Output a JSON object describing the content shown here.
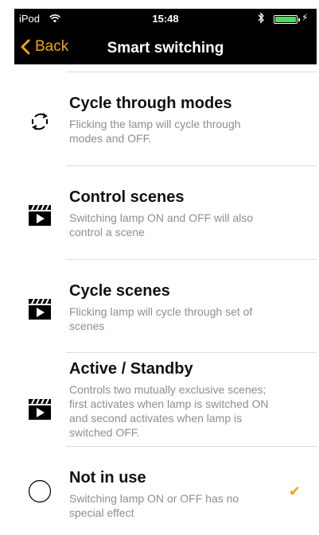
{
  "status_bar": {
    "carrier": "iPod",
    "time": "15:48",
    "bolt": "⚡"
  },
  "nav": {
    "back_label": "Back",
    "title": "Smart switching"
  },
  "options": [
    {
      "title": "Cycle through modes",
      "description": "Flicking the lamp will cycle through modes and OFF.",
      "icon": "cycle-arrows-icon"
    },
    {
      "title": "Control scenes",
      "description": "Switching lamp ON and OFF will also control a scene",
      "icon": "clapperboard-icon"
    },
    {
      "title": "Cycle scenes",
      "description": "Flicking lamp will cycle through set of scenes",
      "icon": "clapperboard-icon"
    },
    {
      "title": "Active / Standby",
      "description": "Controls two mutually exclusive scenes; first activates when lamp is switched ON and second activates when lamp is switched OFF.",
      "icon": "clapperboard-icon"
    },
    {
      "title": "Not in use",
      "description": "Switching lamp ON or OFF has no special effect",
      "icon": "empty-circle-icon",
      "selected": true
    }
  ],
  "checkmark": "✔",
  "colors": {
    "accent": "#f0a21b",
    "bar_background": "#000000",
    "description_text": "#8e8e93",
    "battery": "#4cd964"
  }
}
